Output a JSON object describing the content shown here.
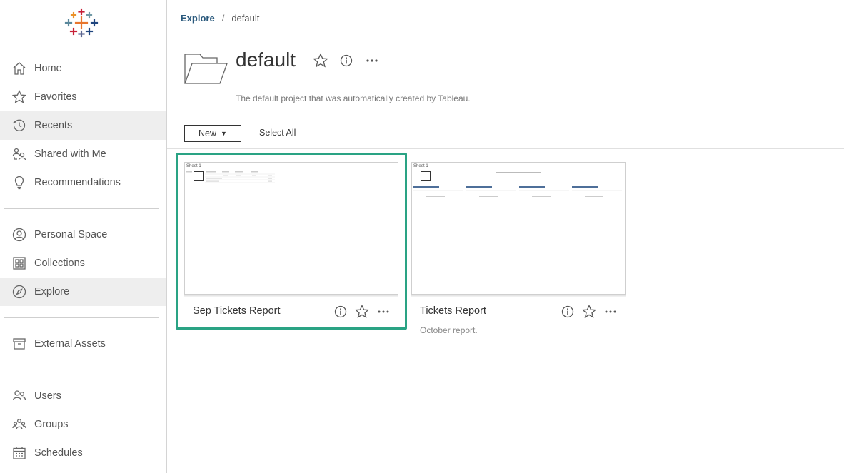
{
  "sidebar": {
    "items": [
      {
        "label": "Home",
        "icon": "home-icon"
      },
      {
        "label": "Favorites",
        "icon": "star-icon"
      },
      {
        "label": "Recents",
        "icon": "recent-icon",
        "active": true
      },
      {
        "label": "Shared with Me",
        "icon": "shared-icon"
      },
      {
        "label": "Recommendations",
        "icon": "lightbulb-icon"
      },
      {
        "label": "Personal Space",
        "icon": "person-icon"
      },
      {
        "label": "Collections",
        "icon": "collections-icon"
      },
      {
        "label": "Explore",
        "icon": "compass-icon",
        "active": true
      },
      {
        "label": "External Assets",
        "icon": "archive-icon"
      },
      {
        "label": "Users",
        "icon": "users-icon"
      },
      {
        "label": "Groups",
        "icon": "groups-icon"
      },
      {
        "label": "Schedules",
        "icon": "calendar-icon"
      }
    ]
  },
  "breadcrumb": {
    "root": "Explore",
    "separator": "/",
    "current": "default"
  },
  "project": {
    "title": "default",
    "description": "The default project that was automatically created by Tableau."
  },
  "toolbar": {
    "new_label": "New",
    "select_all_label": "Select All"
  },
  "cards": [
    {
      "name": "Sep Tickets Report",
      "subtitle": "",
      "thumb_sheet": "Sheet 1",
      "selected": true
    },
    {
      "name": "Tickets Report",
      "subtitle": "October report.",
      "thumb_sheet": "Sheet 1",
      "selected": false
    }
  ],
  "colors": {
    "accent": "#2aa384",
    "link": "#2b5a7d",
    "active_bg": "#eeeeee"
  }
}
